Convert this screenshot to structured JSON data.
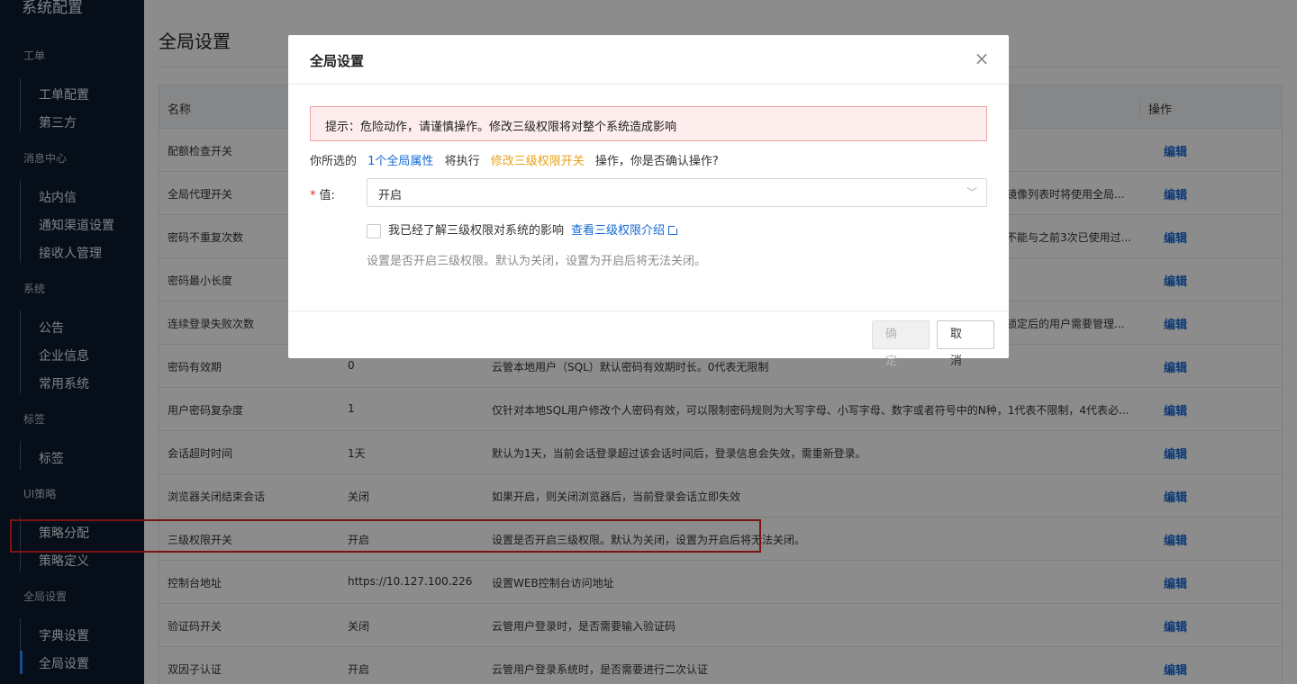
{
  "sidebar": {
    "app_title": "系统配置",
    "groups": [
      {
        "label": "工单",
        "items": [
          "工单配置",
          "第三方"
        ]
      },
      {
        "label": "消息中心",
        "items": [
          "站内信",
          "通知渠道设置",
          "接收人管理"
        ]
      },
      {
        "label": "系统",
        "items": [
          "公告",
          "企业信息",
          "常用系统"
        ]
      },
      {
        "label": "标签",
        "items": [
          "标签"
        ]
      },
      {
        "label": "UI策略",
        "items": [
          "策略分配",
          "策略定义"
        ]
      },
      {
        "label": "全局设置",
        "items": [
          "字典设置",
          "全局设置"
        ]
      }
    ],
    "active_item": "全局设置"
  },
  "page": {
    "title": "全局设置",
    "table": {
      "headers": {
        "name": "名称",
        "action": "操作"
      },
      "edit_label": "编辑",
      "rows": [
        {
          "name": "配额检查开关",
          "value": "",
          "desc": "",
          "desc_right": ""
        },
        {
          "name": "全局代理开关",
          "value": "",
          "desc": "",
          "desc_right": "镜像列表时将使用全局..."
        },
        {
          "name": "密码不重复次数",
          "value": "",
          "desc": "",
          "desc_right": "不能与之前3次已使用过..."
        },
        {
          "name": "密码最小长度",
          "value": "",
          "desc": "",
          "desc_right": ""
        },
        {
          "name": "连续登录失败次数",
          "value": "",
          "desc": "",
          "desc_right": "锁定后的用户需要管理..."
        },
        {
          "name": "密码有效期",
          "value": "0",
          "desc": "云管本地用户（SQL）默认密码有效期时长。0代表无限制",
          "desc_right": ""
        },
        {
          "name": "用户密码复杂度",
          "value": "1",
          "desc": "仅针对本地SQL用户修改个人密码有效，可以限制密码规则为大写字母、小写字母、数字或者符号中的N种，1代表不限制，4代表必...",
          "desc_right": ""
        },
        {
          "name": "会话超时时间",
          "value": "1天",
          "desc": "默认为1天，当前会话登录超过该会话时间后，登录信息会失效，需重新登录。",
          "desc_right": ""
        },
        {
          "name": "浏览器关闭结束会话",
          "value": "关闭",
          "desc": "如果开启，则关闭浏览器后，当前登录会话立即失效",
          "desc_right": ""
        },
        {
          "name": "三级权限开关",
          "value": "开启",
          "desc": "设置是否开启三级权限。默认为关闭，设置为开启后将无法关闭。",
          "desc_right": ""
        },
        {
          "name": "控制台地址",
          "value": "https://10.127.100.226",
          "desc": "设置WEB控制台访问地址",
          "desc_right": ""
        },
        {
          "name": "验证码开关",
          "value": "关闭",
          "desc": "云管用户登录时，是否需要输入验证码",
          "desc_right": ""
        },
        {
          "name": "双因子认证",
          "value": "开启",
          "desc": "云管用户登录系统时，是否需要进行二次认证",
          "desc_right": ""
        }
      ]
    }
  },
  "modal": {
    "title": "全局设置",
    "close_icon": "×",
    "alert_text": "提示：危险动作，请谨慎操作。修改三级权限将对整个系统造成影响",
    "confirm": {
      "prefix": "你所选的",
      "selection": "1个全局属性",
      "middle": "将执行",
      "action": "修改三级权限开关",
      "suffix": "操作，你是否确认操作?"
    },
    "value_label": "值:",
    "value_selected": "开启",
    "checkbox_label": "我已经了解三级权限对系统的影响",
    "link_label": "查看三级权限介绍",
    "help_text": "设置是否开启三级权限。默认为关闭，设置为开启后将无法关闭。",
    "ok_label": "确 定",
    "cancel_label": "取 消"
  },
  "colors": {
    "accent": "#1469d6",
    "warning": "#e7a21a",
    "danger": "#e32626",
    "sidebar_bg": "#0a1a2e"
  }
}
